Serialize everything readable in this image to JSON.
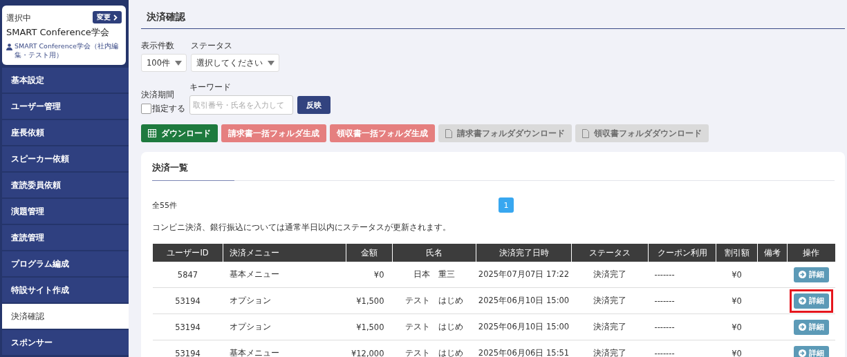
{
  "sidebar": {
    "selected_label": "選択中",
    "change_button": "変更",
    "org_name": "SMART Conference学会",
    "org_user": "SMART Conference学会（社内編集・テスト用）",
    "items": [
      {
        "label": "基本設定",
        "selected": false
      },
      {
        "label": "ユーザー管理",
        "selected": false
      },
      {
        "label": "座長依頼",
        "selected": false
      },
      {
        "label": "スピーカー依頼",
        "selected": false
      },
      {
        "label": "査読委員依頼",
        "selected": false
      },
      {
        "label": "演題管理",
        "selected": false
      },
      {
        "label": "査読管理",
        "selected": false
      },
      {
        "label": "プログラム編成",
        "selected": false
      },
      {
        "label": "特設サイト作成",
        "selected": false
      },
      {
        "label": "決済確認",
        "selected": true
      },
      {
        "label": "スポンサー",
        "selected": false
      }
    ]
  },
  "page_title": "決済確認",
  "filters": {
    "count": {
      "label": "表示件数",
      "value": "100件"
    },
    "status": {
      "label": "ステータス",
      "value": "選択してください"
    },
    "period": {
      "label": "決済期間",
      "checkbox_label": "指定する",
      "checked": false
    },
    "keyword": {
      "label": "キーワード",
      "placeholder": "取引番号・氏名を入力して"
    },
    "apply_button": "反映"
  },
  "actions": [
    {
      "label": "ダウンロード",
      "kind": "primary"
    },
    {
      "label": "請求書一括フォルダ生成",
      "kind": "danger"
    },
    {
      "label": "領収書一括フォルダ生成",
      "kind": "danger"
    },
    {
      "label": "請求書フォルダダウンロード",
      "kind": "disabled"
    },
    {
      "label": "領収書フォルダダウンロード",
      "kind": "disabled"
    }
  ],
  "list": {
    "title": "決済一覧",
    "total": "全55件",
    "pages": [
      {
        "label": "1",
        "selected": true
      }
    ],
    "notice": "コンビニ決済、銀行振込については通常半日以内にステータスが更新されます。",
    "columns": [
      "ユーザーID",
      "決済メニュー",
      "金額",
      "氏名",
      "決済完了日時",
      "ステータス",
      "クーポン利用",
      "割引額",
      "備考",
      "操作"
    ],
    "rows": [
      {
        "cells": [
          "5847",
          "基本メニュー",
          "¥0",
          "日本　重三",
          "2025年07月07日 17:22",
          "決済完了",
          "-------",
          "¥0",
          ""
        ],
        "detail_button": "詳細",
        "highlighted": false
      },
      {
        "cells": [
          "53194",
          "オプション",
          "¥1,500",
          "テスト　はじめ",
          "2025年06月10日 15:00",
          "決済完了",
          "-------",
          "¥0",
          ""
        ],
        "detail_button": "詳細",
        "highlighted": true
      },
      {
        "cells": [
          "53194",
          "オプション",
          "¥1,500",
          "テスト　はじめ",
          "2025年06月10日 15:00",
          "決済完了",
          "-------",
          "¥0",
          ""
        ],
        "detail_button": "詳細",
        "highlighted": false
      },
      {
        "cells": [
          "53194",
          "基本メニュー",
          "¥12,000",
          "テスト　はじめ",
          "2025年06月06日 15:51",
          "決済完了",
          "-------",
          "¥0",
          ""
        ],
        "detail_button": "詳細",
        "highlighted": false
      }
    ]
  }
}
